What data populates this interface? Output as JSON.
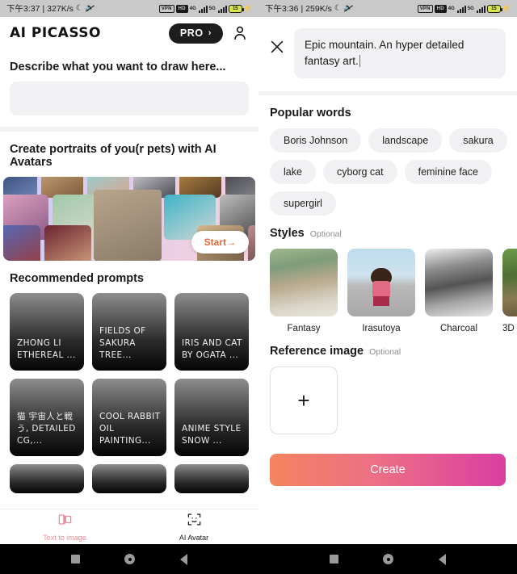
{
  "left": {
    "status": {
      "time": "下午3:37",
      "separator": "|",
      "speed": "327K/s",
      "moon_icon": "moon-icon",
      "mute_icon": "sound-off-icon",
      "vpn_badge": "VPN",
      "hd_badge": "HD",
      "gen_4g": "4G",
      "gen_5g": "5G",
      "battery_level": "15"
    },
    "header": {
      "brand": "AI PICASSO",
      "pro_label": "PRO",
      "pro_chevron": "›",
      "account_icon": "person-icon"
    },
    "describe_title": "Describe what you want to draw here...",
    "avatar_banner": {
      "title": "Create portraits of you(r pets) with AI Avatars",
      "start_label": "Start→"
    },
    "recommended": {
      "title": "Recommended prompts",
      "cards": [
        "ZHONG LI ETHEREAL ...",
        "FIELDS OF SAKURA TREE...",
        "IRIS AND CAT BY OGATA ...",
        "猫 宇宙人と戦う, DETAILED CG,...",
        "COOL RABBIT OIL PAINTING...",
        "ANIME STYLE SNOW ..."
      ]
    },
    "tabs": [
      {
        "label": "Text to image",
        "icon": "text-to-image-icon",
        "active": true
      },
      {
        "label": "AI Avatar",
        "icon": "face-scan-icon",
        "active": false
      }
    ]
  },
  "right": {
    "status": {
      "time": "下午3:36",
      "separator": "|",
      "speed": "259K/s",
      "moon_icon": "moon-icon",
      "mute_icon": "sound-off-icon",
      "vpn_badge": "VPN",
      "hd_badge": "HD",
      "gen_4g": "4G",
      "gen_5g": "5G",
      "battery_level": "15"
    },
    "close_icon": "close-icon",
    "prompt_value": "Epic mountain. An hyper detailed fantasy art.",
    "popular": {
      "title": "Popular words",
      "words": [
        "Boris Johnson",
        "landscape",
        "sakura",
        "lake",
        "cyborg cat",
        "feminine face",
        "supergirl"
      ]
    },
    "styles": {
      "title": "Styles",
      "optional": "Optional",
      "items": [
        {
          "label": "Fantasy",
          "thumb": "fantasy-cottage-thumb"
        },
        {
          "label": "Irasutoya",
          "thumb": "irasutoya-girl-thumb"
        },
        {
          "label": "Charcoal",
          "thumb": "charcoal-cottage-thumb"
        },
        {
          "label": "3D",
          "thumb": "3d-forest-thumb"
        }
      ]
    },
    "reference": {
      "title": "Reference image",
      "optional": "Optional",
      "add_icon": "plus-icon"
    },
    "create_label": "Create"
  },
  "navbar": {
    "recents_icon": "square-icon",
    "home_icon": "circle-icon",
    "back_icon": "back-triangle-icon"
  },
  "colors": {
    "accent_pink": "#e98b97",
    "create_gradient_start": "#f4845f",
    "create_gradient_end": "#d93fa0",
    "start_button_text": "#e06a3a",
    "caret": "#2e7ad1"
  }
}
